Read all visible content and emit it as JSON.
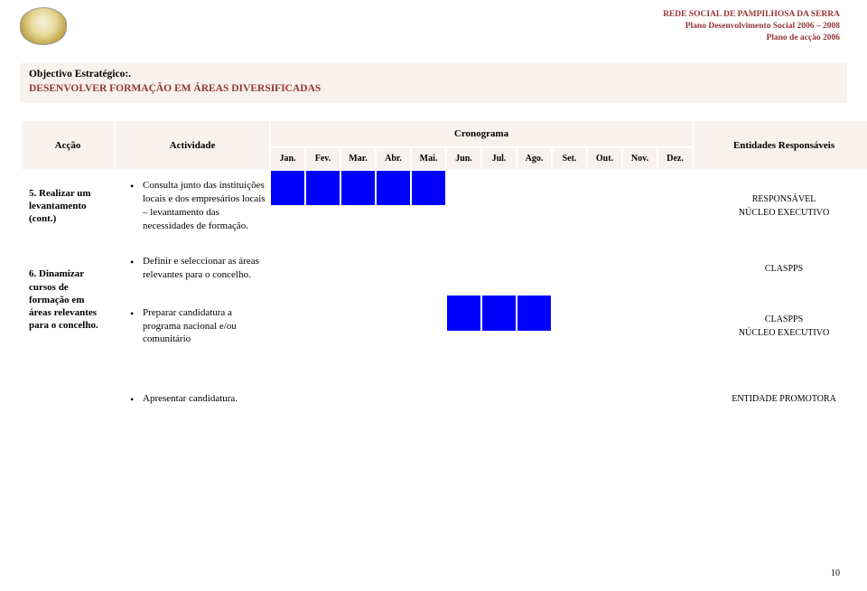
{
  "header": {
    "line1": "REDE SOCIAL DE PAMPILHOSA DA SERRA",
    "line2": "Plano Desenvolvimento Social 2006 – 2008",
    "line3": "Plano de acção 2006"
  },
  "objective": {
    "label": "Objectivo Estratégico:.",
    "title": "DESENVOLVER FORMAÇÃO EM ÁREAS DIVERSIFICADAS"
  },
  "table": {
    "col_accao": "Acção",
    "col_actividade": "Actividade",
    "col_cronograma": "Cronograma",
    "col_entidades": "Entidades Responsáveis",
    "months": [
      "Jan.",
      "Fev.",
      "Mar.",
      "Abr.",
      "Mai.",
      "Jun.",
      "Jul.",
      "Ago.",
      "Set.",
      "Out.",
      "Nov.",
      "Dez."
    ]
  },
  "accoes": {
    "a5": "5. Realizar um levantamento (cont.)",
    "a6": "6. Dinamizar cursos de formação em áreas relevantes para o concelho."
  },
  "rows": {
    "r1": {
      "act": "Consulta junto das instituições locais e dos empresários locais – levantamento das necessidades de formação.",
      "ent1": "RESPONSÁVEL",
      "ent2": "NÚCLEO EXECUTIVO"
    },
    "r2": {
      "act": "Definir e seleccionar as áreas relevantes para o concelho.",
      "ent1": "CLASPPS"
    },
    "r3": {
      "act": "Preparar candidatura a programa nacional e/ou comunitário",
      "ent1": "CLASPPS",
      "ent2": "NÚCLEO EXECUTIVO"
    },
    "r4": {
      "act": "Apresentar candidatura.",
      "ent1": "ENTIDADE PROMOTORA"
    }
  },
  "gantt": {
    "r1_m": [
      true,
      true,
      true,
      true,
      true,
      false,
      false,
      false,
      false,
      false,
      false,
      false
    ],
    "r2_m": [
      false,
      false,
      false,
      false,
      false,
      false,
      false,
      false,
      false,
      false,
      false,
      false
    ],
    "r3_m": [
      false,
      false,
      false,
      false,
      false,
      true,
      true,
      true,
      false,
      false,
      false,
      false
    ],
    "r4_m": [
      false,
      false,
      false,
      false,
      false,
      false,
      false,
      false,
      false,
      false,
      false,
      false
    ]
  },
  "page_number": "10"
}
